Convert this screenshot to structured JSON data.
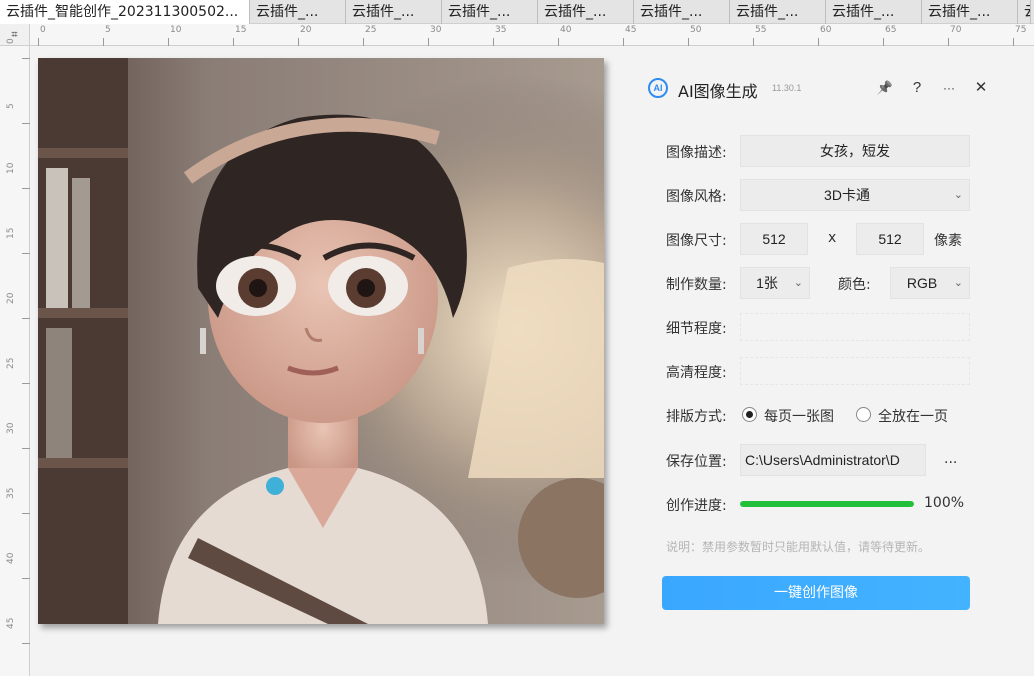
{
  "tabs": [
    {
      "label": "云插件_智能创作_202311300502..."
    },
    {
      "label": "云插件_..."
    },
    {
      "label": "云插件_..."
    },
    {
      "label": "云插件_..."
    },
    {
      "label": "云插件_..."
    },
    {
      "label": "云插件_..."
    },
    {
      "label": "云插件_..."
    },
    {
      "label": "云插件_..."
    },
    {
      "label": "云插件_..."
    },
    {
      "label": "云插件_..."
    }
  ],
  "ruler": {
    "corner_glyph": "⌗",
    "h_ticks": [
      "0",
      "5",
      "10",
      "15",
      "20",
      "25",
      "30",
      "35",
      "40",
      "45",
      "50",
      "55",
      "60",
      "65",
      "70",
      "75"
    ],
    "v_ticks": [
      "0",
      "5",
      "10",
      "15",
      "20",
      "25",
      "30",
      "35",
      "40",
      "45"
    ]
  },
  "panel": {
    "logo_text": "AI",
    "title": "AI图像生成",
    "version": "11.30.1",
    "pin_icon": "📌",
    "help_icon": "?",
    "more_icon": "···",
    "close_icon": "✕",
    "description": {
      "label": "图像描述:",
      "value": "女孩，短发"
    },
    "style": {
      "label": "图像风格:",
      "value": "3D卡通"
    },
    "size": {
      "label": "图像尺寸:",
      "width": "512",
      "sep": "x",
      "height": "512",
      "unit": "像素"
    },
    "count": {
      "label": "制作数量:",
      "value": "1张"
    },
    "color": {
      "label": "颜色:",
      "value": "RGB"
    },
    "detail": {
      "label": "细节程度:"
    },
    "clarity": {
      "label": "高清程度:"
    },
    "layout": {
      "label": "排版方式:",
      "option1": "每页一张图",
      "option2": "全放在一页",
      "selected": "option1"
    },
    "save": {
      "label": "保存位置:",
      "path": "C:\\Users\\Administrator\\D",
      "browse": "..."
    },
    "progress": {
      "label": "创作进度:",
      "percent_text": "100%",
      "value": 1.0
    },
    "note": "说明：禁用参数暂时只能用默认值，请等待更新。",
    "create_button": "一键创作图像",
    "chevron": "⌄"
  },
  "colors": {
    "accent": "#3aa7ff",
    "progress": "#22c03a"
  }
}
